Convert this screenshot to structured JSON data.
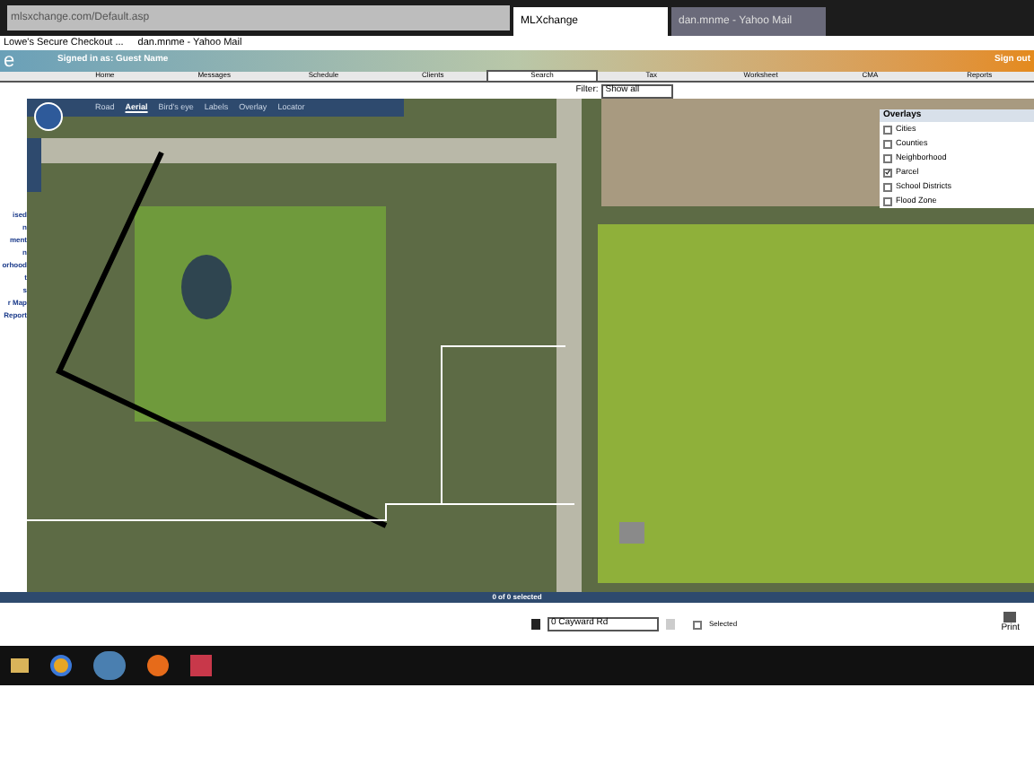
{
  "browser": {
    "address": "mlsxchange.com/Default.asp",
    "tabs": [
      {
        "label": "MLXchange",
        "selected": true
      },
      {
        "label": "dan.mnme - Yahoo Mail",
        "selected": false
      }
    ],
    "favorites": [
      "Lowe's Secure Checkout ...",
      "dan.mnme - Yahoo Mail"
    ]
  },
  "header": {
    "logo": "e",
    "greeting": "Signed in as: Guest Name",
    "sign_out": "Sign out"
  },
  "nav": [
    {
      "label": "Home",
      "selected": false
    },
    {
      "label": "Messages",
      "selected": false
    },
    {
      "label": "Schedule",
      "selected": false
    },
    {
      "label": "Clients",
      "selected": false
    },
    {
      "label": "Search",
      "selected": true
    },
    {
      "label": "Tax",
      "selected": false
    },
    {
      "label": "Worksheet",
      "selected": false
    },
    {
      "label": "CMA",
      "selected": false
    },
    {
      "label": "Reports",
      "selected": false
    }
  ],
  "filter": {
    "label": "Filter:",
    "value": "Show all"
  },
  "sidebar": [
    "ised",
    "n",
    "ment",
    "n",
    "orhood",
    "t",
    "s",
    "r Map",
    "Report"
  ],
  "map_toolbar": [
    {
      "label": "Road",
      "selected": false
    },
    {
      "label": "Aerial",
      "selected": true
    },
    {
      "label": "Bird's eye",
      "selected": false
    },
    {
      "label": "Labels",
      "selected": false
    },
    {
      "label": "Overlay",
      "selected": false
    },
    {
      "label": "Locator",
      "selected": false
    }
  ],
  "overlays": {
    "title": "Overlays",
    "items": [
      {
        "label": "Cities",
        "checked": false
      },
      {
        "label": "Counties",
        "checked": false
      },
      {
        "label": "Neighborhood",
        "checked": false
      },
      {
        "label": "Parcel",
        "checked": true
      },
      {
        "label": "School Districts",
        "checked": false
      },
      {
        "label": "Flood Zone",
        "checked": false
      }
    ]
  },
  "selection_count": "0 of 0 selected",
  "footer": {
    "property": "0 Cayward Rd",
    "selected_label": "Selected",
    "selected": false,
    "print": "Print"
  }
}
